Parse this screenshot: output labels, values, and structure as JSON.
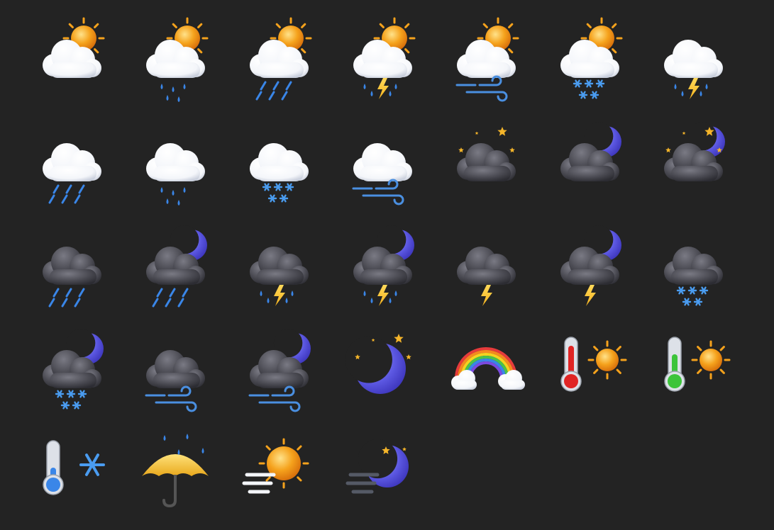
{
  "colors": {
    "background": "#232323",
    "sun": "#F5A21C",
    "cloud_white": "#F4F6FA",
    "cloud_dark": "#4A4A52",
    "moon": "#5A56E0",
    "rain": "#3A86E8",
    "lightning": "#F5B21C",
    "snow": "#4A9CF0",
    "wind": "#4A8FE0"
  },
  "icons": [
    {
      "name": "sun-cloud-icon",
      "parts": [
        "sun",
        "cloud-white"
      ]
    },
    {
      "name": "sun-cloud-drizzle-icon",
      "parts": [
        "sun",
        "cloud-white",
        "drops"
      ]
    },
    {
      "name": "sun-cloud-rain-icon",
      "parts": [
        "sun",
        "cloud-white",
        "streaks"
      ]
    },
    {
      "name": "sun-cloud-thunderstorm-icon",
      "parts": [
        "sun",
        "cloud-white",
        "bolt",
        "drops-small"
      ]
    },
    {
      "name": "sun-cloud-wind-icon",
      "parts": [
        "sun",
        "cloud-white",
        "wind"
      ]
    },
    {
      "name": "sun-cloud-snow-icon",
      "parts": [
        "sun",
        "cloud-white",
        "snow"
      ]
    },
    {
      "name": "cloud-thunderstorm-icon",
      "parts": [
        "cloud-white",
        "bolt",
        "drops-small"
      ]
    },
    {
      "name": "cloud-rain-icon",
      "parts": [
        "cloud-white",
        "streaks"
      ]
    },
    {
      "name": "cloud-drizzle-icon",
      "parts": [
        "cloud-white",
        "drops"
      ]
    },
    {
      "name": "cloud-snow-icon",
      "parts": [
        "cloud-white",
        "snow"
      ]
    },
    {
      "name": "cloud-wind-icon",
      "parts": [
        "cloud-white",
        "wind"
      ]
    },
    {
      "name": "night-cloud-stars-icon",
      "parts": [
        "stars",
        "cloud-dark"
      ]
    },
    {
      "name": "moon-dark-cloud-icon",
      "parts": [
        "moon",
        "cloud-dark"
      ]
    },
    {
      "name": "moon-stars-dark-cloud-icon",
      "parts": [
        "moon",
        "stars",
        "cloud-dark"
      ]
    },
    {
      "name": "dark-cloud-rain-icon",
      "parts": [
        "cloud-dark",
        "streaks"
      ]
    },
    {
      "name": "moon-dark-cloud-rain-icon",
      "parts": [
        "moon",
        "cloud-dark",
        "streaks"
      ]
    },
    {
      "name": "dark-cloud-thunderstorm-icon",
      "parts": [
        "cloud-dark",
        "bolt",
        "drops-small"
      ]
    },
    {
      "name": "moon-dark-cloud-thunderstorm-icon",
      "parts": [
        "moon",
        "cloud-dark",
        "bolt",
        "drops-small"
      ]
    },
    {
      "name": "dark-cloud-lightning-icon",
      "parts": [
        "cloud-dark",
        "bolt"
      ]
    },
    {
      "name": "moon-dark-cloud-lightning-icon",
      "parts": [
        "moon",
        "cloud-dark",
        "bolt"
      ]
    },
    {
      "name": "dark-cloud-snow-icon",
      "parts": [
        "cloud-dark",
        "snow"
      ]
    },
    {
      "name": "moon-dark-cloud-snow-icon",
      "parts": [
        "moon",
        "cloud-dark",
        "snow"
      ]
    },
    {
      "name": "dark-cloud-wind-icon",
      "parts": [
        "cloud-dark",
        "wind"
      ]
    },
    {
      "name": "moon-dark-cloud-wind-icon",
      "parts": [
        "moon",
        "cloud-dark",
        "wind"
      ]
    },
    {
      "name": "crescent-moon-stars-icon",
      "parts": [
        "moon-large",
        "stars"
      ]
    },
    {
      "name": "rainbow-icon",
      "parts": [
        "rainbow"
      ]
    },
    {
      "name": "thermometer-hot-sun-icon",
      "parts": [
        "thermo-hot",
        "sun-small"
      ]
    },
    {
      "name": "thermometer-warm-sun-icon",
      "parts": [
        "thermo-warm",
        "sun-small"
      ]
    },
    {
      "name": "thermometer-cold-snowflake-icon",
      "parts": [
        "thermo-cold",
        "snowflake"
      ]
    },
    {
      "name": "umbrella-rain-icon",
      "parts": [
        "umbrella"
      ]
    },
    {
      "name": "sun-fog-icon",
      "parts": [
        "sun-fog"
      ]
    },
    {
      "name": "moon-fog-icon",
      "parts": [
        "moon-fog"
      ]
    }
  ]
}
